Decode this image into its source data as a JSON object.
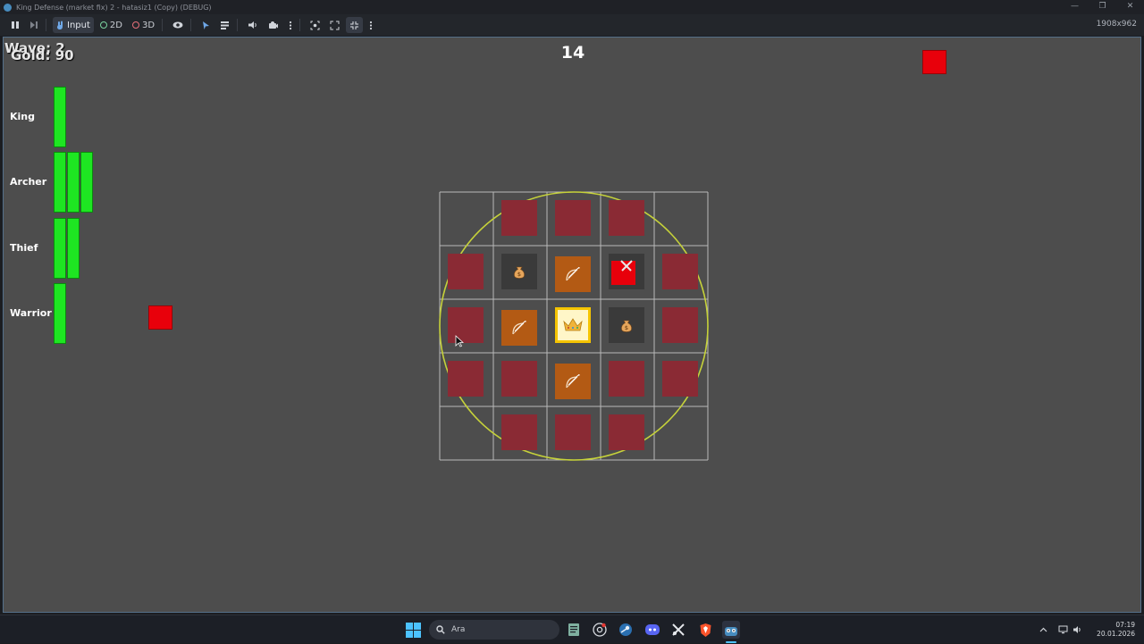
{
  "window": {
    "title": "King Defense (market fix) 2 - hatasiz1 (Copy) (DEBUG)",
    "minimize_glyph": "—",
    "maximize_glyph": "❐",
    "close_glyph": "✕"
  },
  "toolbar": {
    "input_label": "Input",
    "mode_2d_label": "2D",
    "mode_3d_label": "3D",
    "resolution": "1908x962"
  },
  "hud": {
    "wave_text": "Wave: 2",
    "gold_text": "Gold: 90",
    "timer_text": "14"
  },
  "units": [
    {
      "label": "King",
      "bars": 1
    },
    {
      "label": "Archer",
      "bars": 3
    },
    {
      "label": "Thief",
      "bars": 2
    },
    {
      "label": "Warrior",
      "bars": 1
    }
  ],
  "grid": {
    "size": 5,
    "cells": [
      [
        "none",
        "slot",
        "slot",
        "slot",
        "none"
      ],
      [
        "slot",
        "money",
        "archer",
        "warrior",
        "slot"
      ],
      [
        "slot",
        "archer",
        "king",
        "money",
        "slot"
      ],
      [
        "slot",
        "slot",
        "archer",
        "slot",
        "slot"
      ],
      [
        "none",
        "slot",
        "slot",
        "slot",
        "none"
      ]
    ],
    "colors": {
      "slot": "#8a2a34",
      "tower_bg": "#3a3a3a",
      "archer_bg": "#b35a14",
      "king_border": "#f5c400",
      "range_ring": "#c6d23a",
      "enemy": "#e8000b",
      "health_bar": "#1ee622"
    }
  },
  "taskbar": {
    "search_placeholder": "Ara",
    "clock_time": "07:19",
    "clock_date": "20.01.2026",
    "apps": [
      "windows-start-icon",
      "notepad-icon",
      "chrome-icon",
      "steam-icon",
      "discord-icon",
      "snipping-icon",
      "brave-icon",
      "godot-icon"
    ]
  }
}
